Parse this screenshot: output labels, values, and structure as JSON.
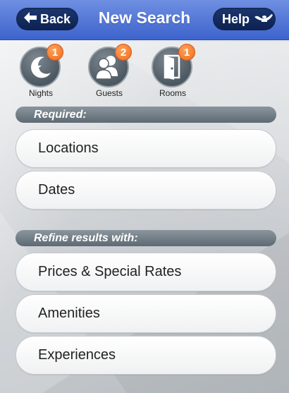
{
  "header": {
    "back_label": "Back",
    "title": "New Search",
    "help_label": "Help"
  },
  "filters": [
    {
      "label": "Nights",
      "badge": "1",
      "icon": "moon-star-icon"
    },
    {
      "label": "Guests",
      "badge": "2",
      "icon": "people-icon"
    },
    {
      "label": "Rooms",
      "badge": "1",
      "icon": "door-icon"
    }
  ],
  "required": {
    "heading": "Required:",
    "items": [
      "Locations",
      "Dates"
    ]
  },
  "refine": {
    "heading": "Refine results with:",
    "items": [
      "Prices & Special Rates",
      "Amenities",
      "Experiences"
    ]
  },
  "colors": {
    "header_blue": "#3d63cc",
    "button_navy": "#0d2150",
    "badge_orange": "#ef6a1a",
    "section_gray": "#5e6a73"
  }
}
